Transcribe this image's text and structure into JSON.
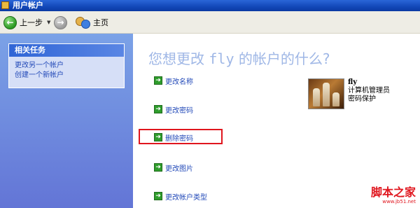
{
  "window": {
    "title": "用户帐户"
  },
  "toolbar": {
    "back_label": "上一步",
    "home_label": "主页"
  },
  "sidebar": {
    "section_title": "相关任务",
    "links": [
      "更改另一个帐户",
      "创建一个新帐户"
    ]
  },
  "main": {
    "heading_prefix": "您想更改",
    "heading_user": "fly",
    "heading_suffix": "的帐户的什么?",
    "tasks": [
      "更改名称",
      "更改密码",
      "删除密码",
      "更改图片",
      "更改帐户类型"
    ],
    "highlighted_task": "删除密码"
  },
  "user": {
    "name": "fly",
    "type": "计算机管理员",
    "status": "密码保护"
  },
  "watermark": {
    "line1": "脚本之家",
    "line2": "www.jb51.net"
  },
  "colors": {
    "titlebar": "#1247b8",
    "sidebar": "#6d8ce0",
    "link": "#2249b8",
    "heading": "#9fb7e6",
    "highlight_border": "#e0161e"
  }
}
